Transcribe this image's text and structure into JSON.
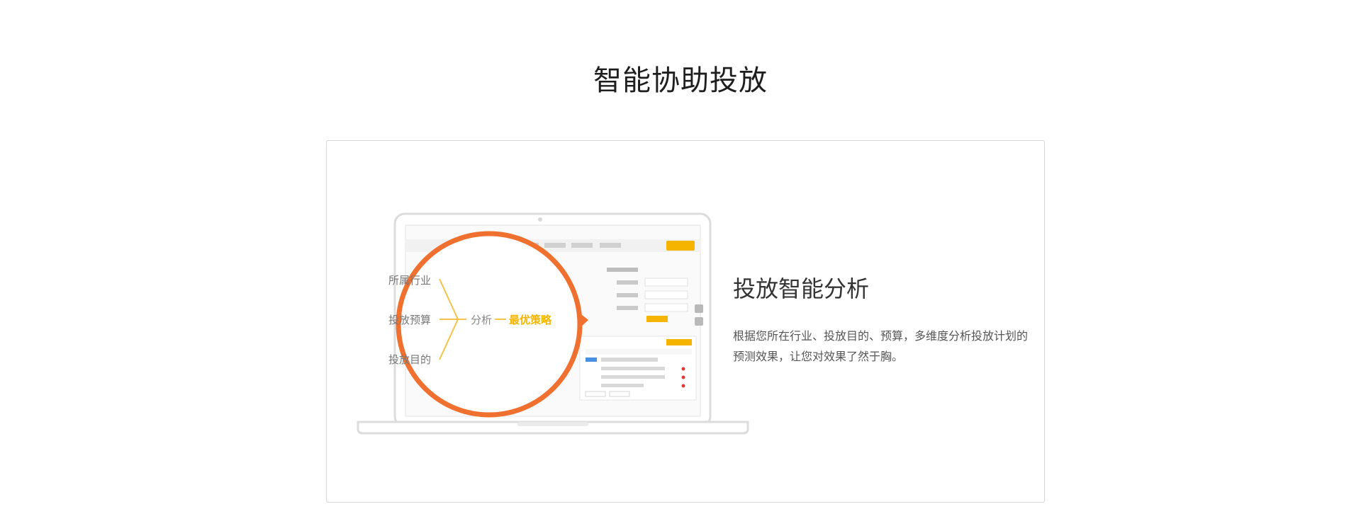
{
  "section": {
    "title": "智能协助投放"
  },
  "feature": {
    "title": "投放智能分析",
    "description": "根据您所在行业、投放目的、预算，多维度分析投放计划的预测效果，让您对效果了然于胸。"
  },
  "illustration": {
    "inputs": [
      "所属行业",
      "投放预算",
      "投放目的"
    ],
    "analyze_label": "分析",
    "result_label": "最优策略",
    "colors": {
      "accent": "#f07030",
      "gold": "#f5b400",
      "line": "#f5c24a",
      "laptop": "#dcdcdc"
    }
  }
}
